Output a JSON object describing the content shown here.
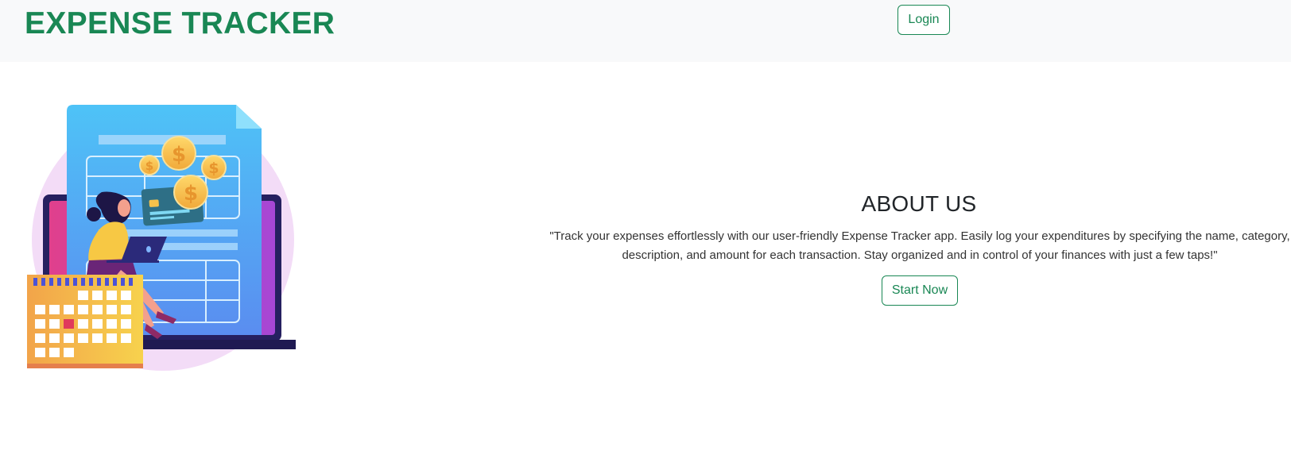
{
  "navbar": {
    "brand": "EXPENSE TRACKER",
    "login_label": "Login"
  },
  "about": {
    "title": "ABOUT US",
    "description": "\"Track your expenses effortlessly with our user-friendly Expense Tracker app. Easily log your expenditures by specifying the name, category, description, and amount for each transaction. Stay organized and in control of your finances with just a few taps!\"",
    "cta_label": "Start Now"
  },
  "hero": {
    "currency_symbol": "$",
    "icon_names": [
      "document-icon",
      "laptop-icon",
      "coin-icon",
      "credit-card-icon",
      "calendar-icon",
      "person-illustration"
    ]
  },
  "colors": {
    "brand_green": "#198754",
    "navbar_bg": "#f8f9fa",
    "document_blue": "#4fa6f4",
    "coin_gold": "#f5c14b",
    "laptop_magenta": "#c93f9e"
  }
}
